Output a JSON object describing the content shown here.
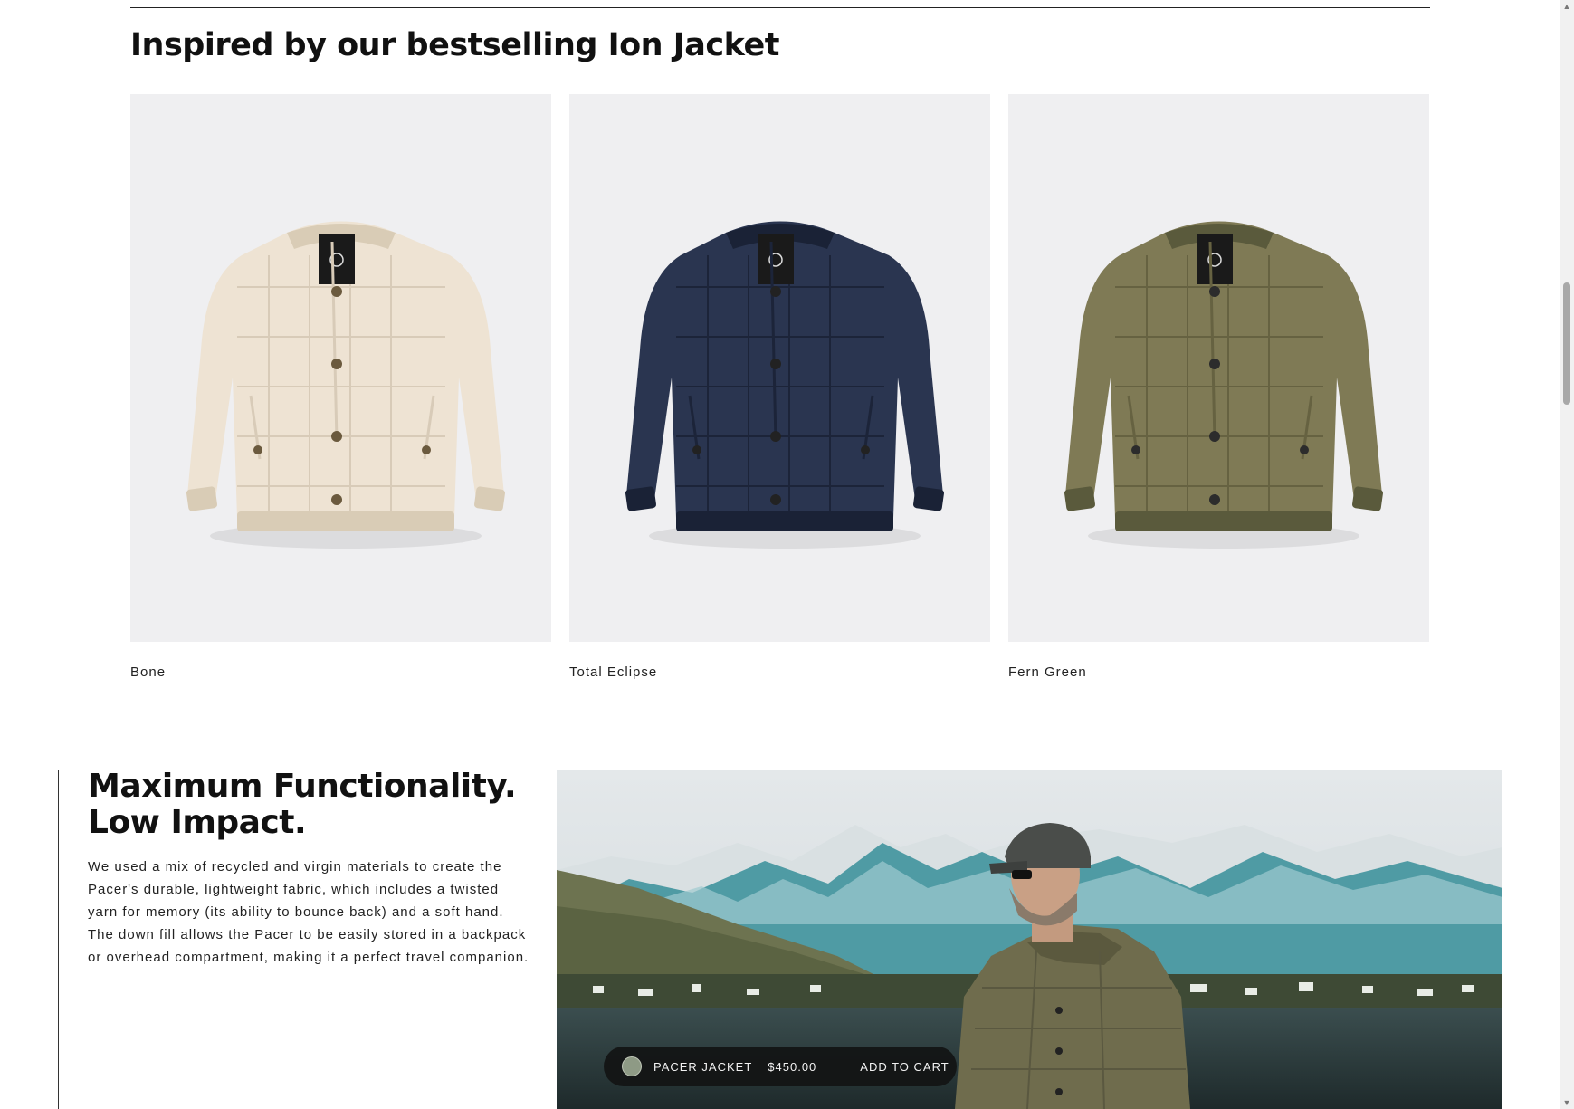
{
  "section": {
    "title": "Inspired by our bestselling Ion Jacket"
  },
  "products": [
    {
      "label": "Bone",
      "color": "#eee3d3",
      "shade": "#d8cbb8",
      "rib": "#d9ccb6",
      "button": "#6b5a3e"
    },
    {
      "label": "Total Eclipse",
      "color": "#2a3550",
      "shade": "#1c2439",
      "rib": "#1a2236",
      "button": "#222"
    },
    {
      "label": "Fern Green",
      "color": "#7f7a55",
      "shade": "#666241",
      "rib": "#5a5a3c",
      "button": "#2c2c2c"
    }
  ],
  "feature": {
    "title_line1": "Maximum Functionality.",
    "title_line2": "Low Impact.",
    "body": "We used a mix of recycled and virgin materials to create the Pacer's durable, lightweight fabric, which includes a twisted yarn for memory (its ability to bounce back) and a soft hand. The down fill allows the Pacer to be easily stored in a backpack or overhead compartment, making it a perfect travel companion."
  },
  "cart_bar": {
    "product_name": "PACER JACKET",
    "price": "$450.00",
    "add_to_cart_label": "ADD TO CART",
    "swatch_color": "#8e9a85"
  }
}
